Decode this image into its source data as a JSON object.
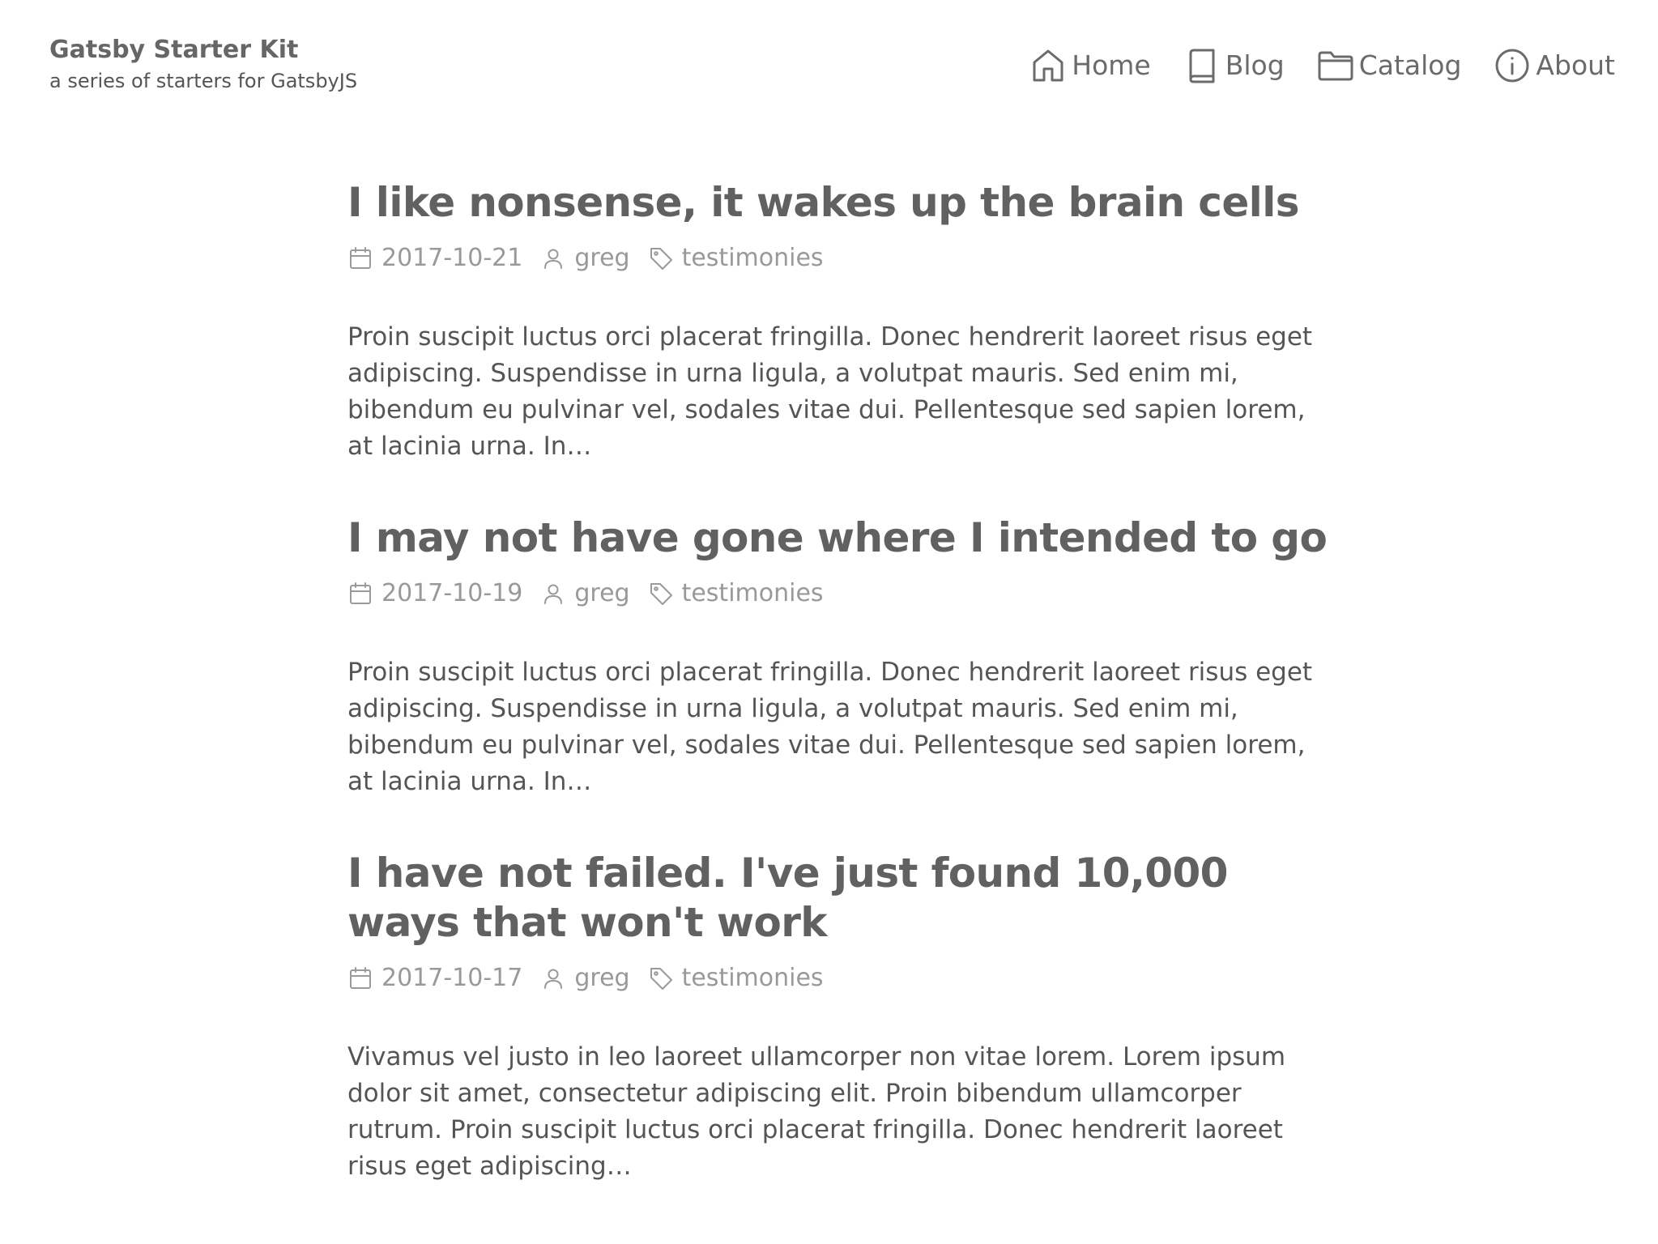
{
  "header": {
    "site_title": "Gatsby Starter Kit",
    "site_subtitle": "a series of starters for GatsbyJS"
  },
  "nav": {
    "items": [
      {
        "label": "Home",
        "icon": "home-icon"
      },
      {
        "label": "Blog",
        "icon": "book-icon"
      },
      {
        "label": "Catalog",
        "icon": "folder-icon"
      },
      {
        "label": "About",
        "icon": "info-icon"
      }
    ]
  },
  "posts": [
    {
      "title": "I like nonsense, it wakes up the brain cells",
      "date": "2017-10-21",
      "author": "greg",
      "category": "testimonies",
      "excerpt": "Proin suscipit luctus orci placerat fringilla. Donec hendrerit laoreet risus eget adipiscing. Suspendisse in urna ligula, a volutpat mauris. Sed enim mi, bibendum eu pulvinar vel, sodales vitae dui. Pellentesque sed sapien lorem, at lacinia urna. In…"
    },
    {
      "title": "I may not have gone where I intended to go",
      "date": "2017-10-19",
      "author": "greg",
      "category": "testimonies",
      "excerpt": "Proin suscipit luctus orci placerat fringilla. Donec hendrerit laoreet risus eget adipiscing. Suspendisse in urna ligula, a volutpat mauris. Sed enim mi, bibendum eu pulvinar vel, sodales vitae dui. Pellentesque sed sapien lorem, at lacinia urna. In…"
    },
    {
      "title": "I have not failed. I've just found 10,000 ways that won't work",
      "date": "2017-10-17",
      "author": "greg",
      "category": "testimonies",
      "excerpt": "Vivamus vel justo in leo laoreet ullamcorper non vitae lorem. Lorem ipsum dolor sit amet, consectetur adipiscing elit. Proin bibendum ullamcorper rutrum. Proin suscipit luctus orci placerat fringilla. Donec hendrerit laoreet risus eget adipiscing…"
    }
  ]
}
